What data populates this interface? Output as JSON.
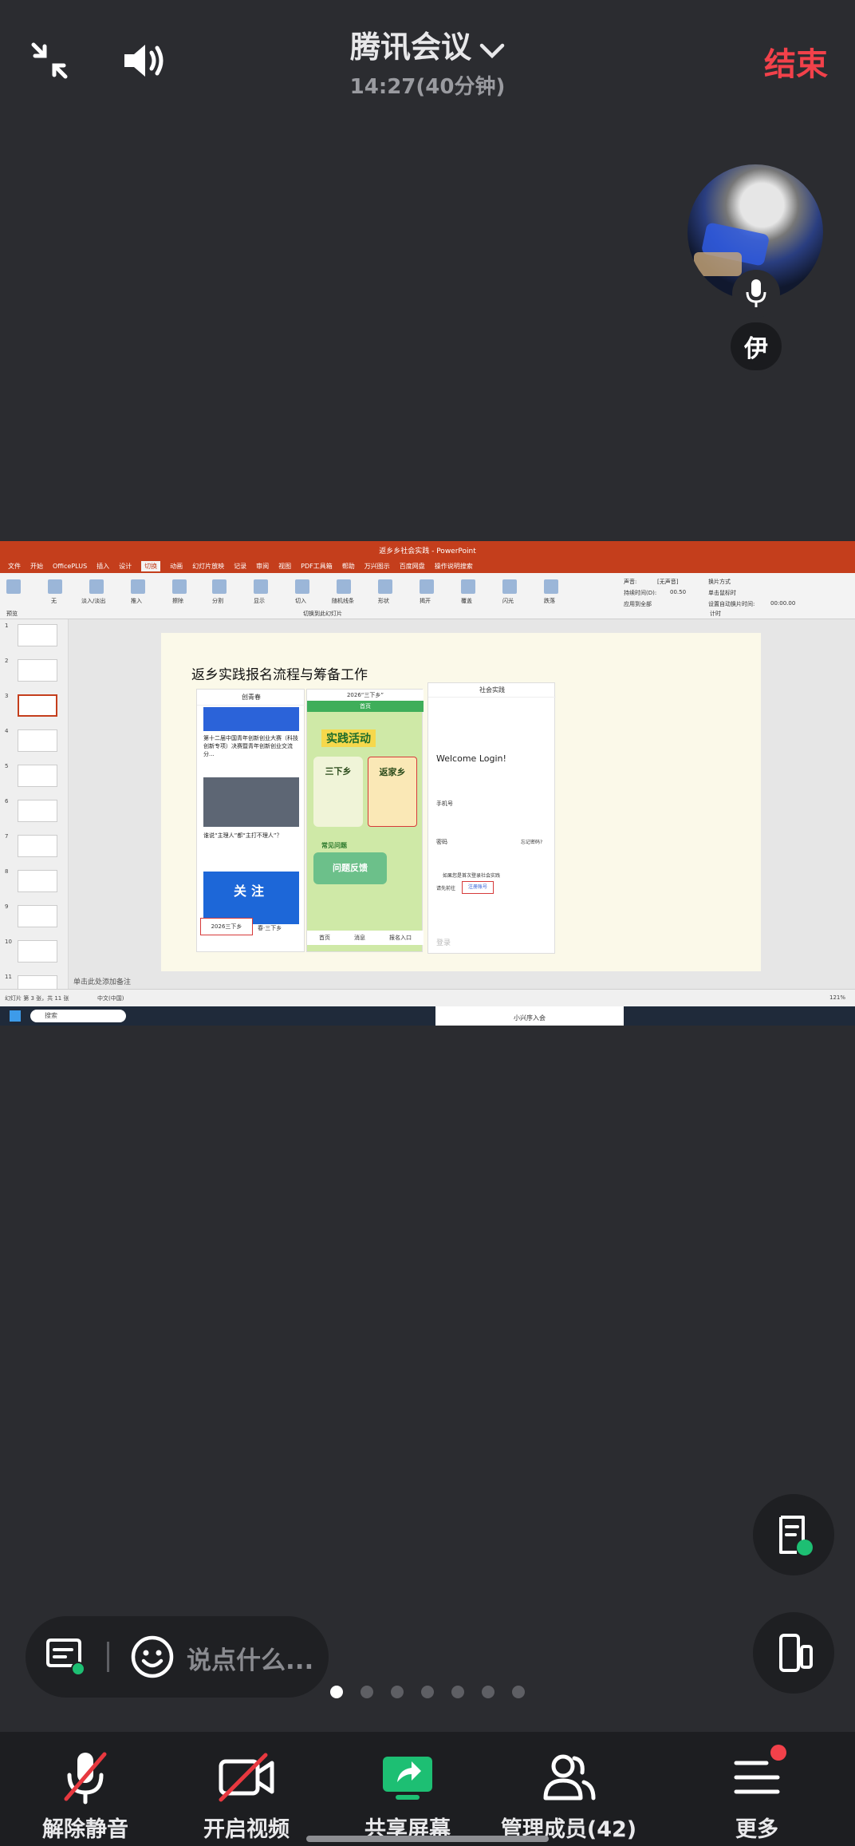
{
  "header": {
    "title": "腾讯会议",
    "time": "14:27(40分钟)",
    "end_label": "结束"
  },
  "participant": {
    "name_initial": "伊"
  },
  "shared_screen": {
    "window_title": "返乡乡社会实践 - PowerPoint",
    "ribbon_tabs": [
      "文件",
      "开始",
      "OfficePLUS",
      "插入",
      "设计",
      "切换",
      "动画",
      "幻灯片放映",
      "记录",
      "审阅",
      "视图",
      "PDF工具箱",
      "帮助",
      "万兴图示",
      "百度网盘",
      "操作说明搜索"
    ],
    "active_tab": "切换",
    "ribbon_items": [
      "无",
      "淡入/淡出",
      "推入",
      "擦除",
      "分割",
      "显示",
      "切入",
      "随机线条",
      "形状",
      "揭开",
      "覆盖",
      "闪光",
      "跌落"
    ],
    "ribbon_options": [
      "声音:",
      "[无声音]",
      "持续时间(D):",
      "00.50",
      "应用到全部",
      "换片方式",
      "单击鼠标时",
      "设置自动换片时间:",
      "00:00.00"
    ],
    "group_labels": [
      "预览",
      "切换到此幻灯片",
      "计时"
    ],
    "slide_numbers": [
      "1",
      "2",
      "3",
      "4",
      "5",
      "6",
      "7",
      "8",
      "9",
      "10",
      "11"
    ],
    "slide_title": "返乡实践报名流程与筹备工作",
    "phone1": {
      "header": "创青春",
      "item1": "第十二届中国青年创新创业大赛（科技创新专项）决赛暨青年创新创业交流分...",
      "item2": "谁说“主理人”都“主打不理人”？",
      "banner": "关注",
      "highlight": "2026三下乡",
      "sub": "春·三下乡"
    },
    "phone2": {
      "header": "2026“三下乡”",
      "tab": "首页",
      "banner": "实践活动",
      "card1": "三下乡",
      "card2": "返家乡",
      "section": "常见问题",
      "card3": "问题反馈",
      "nav": [
        "首页",
        "消息",
        "报名入口"
      ]
    },
    "phone3": {
      "header": "社会实践",
      "welcome": "Welcome Login!",
      "field1": "手机号",
      "field2": "密码",
      "forgot": "忘记密码?",
      "note": "如果您是首次登录社会实践",
      "register_prefix": "请先前往",
      "register": "注册账号",
      "login": "登录"
    },
    "notes": "单击此处添加备注",
    "status_left": "幻灯片 第 3 张，共 11 张",
    "status_lang": "中文(中国)",
    "zoom": "121%",
    "taskbar_search": "搜索",
    "taskbar_bottom_text": "小兴序入会"
  },
  "chat": {
    "placeholder": "说点什么..."
  },
  "pager": {
    "count": 7,
    "active": 0
  },
  "bottom_bar": {
    "items": [
      {
        "label": "解除静音",
        "icon": "mic-muted-icon"
      },
      {
        "label": "开启视频",
        "icon": "video-off-icon"
      },
      {
        "label": "共享屏幕",
        "icon": "share-screen-icon"
      },
      {
        "label": "管理成员(42)",
        "icon": "members-icon"
      },
      {
        "label": "更多",
        "icon": "menu-icon"
      }
    ]
  },
  "colors": {
    "background": "#2b2c30",
    "end": "#f2414a",
    "share_green": "#1dbf73",
    "ppt_orange": "#c43e1c"
  }
}
